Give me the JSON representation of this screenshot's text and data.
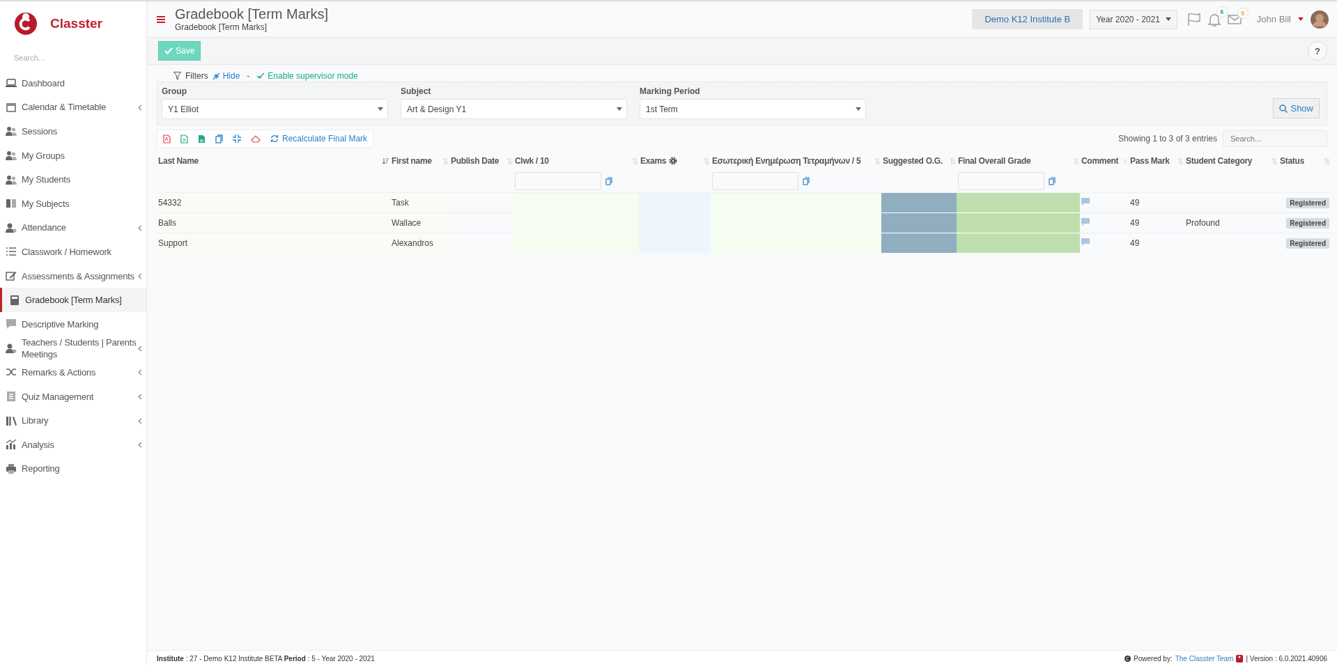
{
  "sidebar": {
    "brand": "Classter",
    "search": {
      "placeholder": "Search..."
    },
    "items": [
      {
        "label": "Dashboard",
        "selected": false,
        "expandable": false
      },
      {
        "label": "Calendar & Timetable",
        "selected": false,
        "expandable": true
      },
      {
        "label": "Sessions",
        "selected": false,
        "expandable": false
      },
      {
        "label": "My Groups",
        "selected": false,
        "expandable": false
      },
      {
        "label": "My Students",
        "selected": false,
        "expandable": false
      },
      {
        "label": "My Subjects",
        "selected": false,
        "expandable": false
      },
      {
        "label": "Attendance",
        "selected": false,
        "expandable": true
      },
      {
        "label": "Classwork / Homework",
        "selected": false,
        "expandable": false
      },
      {
        "label": "Assessments & Assignments",
        "selected": false,
        "expandable": true
      },
      {
        "label": "Gradebook [Term Marks]",
        "selected": true,
        "expandable": false
      },
      {
        "label": "Descriptive Marking",
        "selected": false,
        "expandable": false
      },
      {
        "label": "Teachers / Students | Parents Meetings",
        "selected": false,
        "expandable": true
      },
      {
        "label": "Remarks & Actions",
        "selected": false,
        "expandable": true
      },
      {
        "label": "Quiz Management",
        "selected": false,
        "expandable": true
      },
      {
        "label": "Library",
        "selected": false,
        "expandable": true
      },
      {
        "label": "Analysis",
        "selected": false,
        "expandable": true
      },
      {
        "label": "Reporting",
        "selected": false,
        "expandable": false
      }
    ]
  },
  "header": {
    "title": "Gradebook [Term Marks]",
    "breadcrumb": "Gradebook [Term Marks]",
    "institute": "Demo K12 Institute B",
    "year": "Year 2020 - 2021",
    "notifications": "6",
    "messages": "5",
    "user": "John Bill"
  },
  "toolbar": {
    "save": "Save",
    "help": "?"
  },
  "filters": {
    "label": "Filters",
    "hide": "Hide",
    "separator": "-",
    "supervisor": "Enable supervisor mode",
    "fields": [
      {
        "label": "Group",
        "value": "Y1 Elliot"
      },
      {
        "label": "Subject",
        "value": "Art & Design Y1"
      },
      {
        "label": "Marking Period",
        "value": "1st Term"
      }
    ],
    "show": "Show"
  },
  "table": {
    "recalculate": "Recalculate Final Mark",
    "info": "Showing 1 to 3 of 3 entries",
    "search": {
      "placeholder": "Search..."
    },
    "columns": [
      {
        "label": "Last Name",
        "kind": "last",
        "sorted": true,
        "filter": false
      },
      {
        "label": "First name",
        "kind": "first",
        "sorted": false,
        "filter": false
      },
      {
        "label": "Publish Date",
        "kind": "date",
        "sorted": false,
        "filter": false
      },
      {
        "label": "Clwk / 10",
        "kind": "clwk",
        "sorted": false,
        "filter": true
      },
      {
        "label": "Exams",
        "kind": "exams",
        "sorted": false,
        "filter": false
      },
      {
        "label": "Εσωτερική Ενημέρωση Τετραμήνων / 5",
        "kind": "internal",
        "sorted": false,
        "filter": true
      },
      {
        "label": "Suggested O.G.",
        "kind": "suggested",
        "sorted": false,
        "filter": false
      },
      {
        "label": "Final Overall Grade",
        "kind": "final",
        "sorted": false,
        "filter": true
      },
      {
        "label": "Comment",
        "kind": "comment",
        "sorted": false,
        "filter": false
      },
      {
        "label": "Pass Mark",
        "kind": "pass",
        "sorted": false,
        "filter": false
      },
      {
        "label": "Student Category",
        "kind": "category",
        "sorted": false,
        "filter": false
      },
      {
        "label": "Status",
        "kind": "status",
        "sorted": false,
        "filter": false
      }
    ],
    "rows": [
      {
        "last_name": "54332",
        "first_name": "Task",
        "pass_mark": "49",
        "status": "Registered"
      },
      {
        "last_name": "Balls",
        "first_name": "Wallace",
        "pass_mark": "49",
        "category": "Profound",
        "status": "Registered"
      },
      {
        "last_name": "Support",
        "first_name": "Alexandros",
        "pass_mark": "49",
        "status": "Registered"
      }
    ]
  },
  "footer": {
    "info": "**Institute** : 27 - Demo K12 Institute BETA **Period** : 5 - Year 2020 - 2021",
    "powered": "Powered by:",
    "team": "The Classter Team",
    "version": "| Version : 6.0.2021.40906"
  }
}
